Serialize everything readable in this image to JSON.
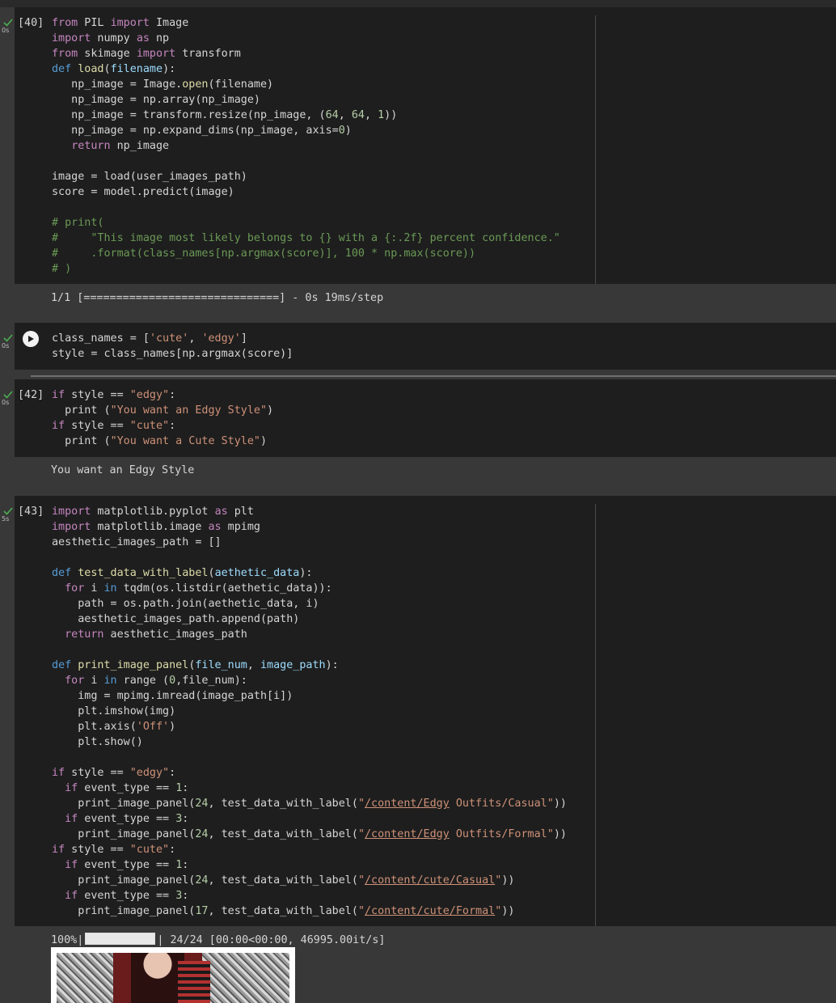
{
  "cells": [
    {
      "prompt": "[40]",
      "time": "0s",
      "output": "1/1 [==============================] - 0s 19ms/step"
    },
    {
      "prompt": "",
      "time": "0s"
    },
    {
      "prompt": "[42]",
      "time": "0s",
      "output": "You want an Edgy Style"
    },
    {
      "prompt": "[43]",
      "time": "5s",
      "progress_percent": "100%",
      "progress_fraction": 1.0,
      "progress_text": "24/24 [00:00<00:00, 46995.00it/s]"
    }
  ],
  "icons": {
    "status": "check-icon",
    "run": "play-icon"
  },
  "colors": {
    "background": "#383838",
    "cell": "#1e1e1e",
    "check": "#4caf50"
  }
}
